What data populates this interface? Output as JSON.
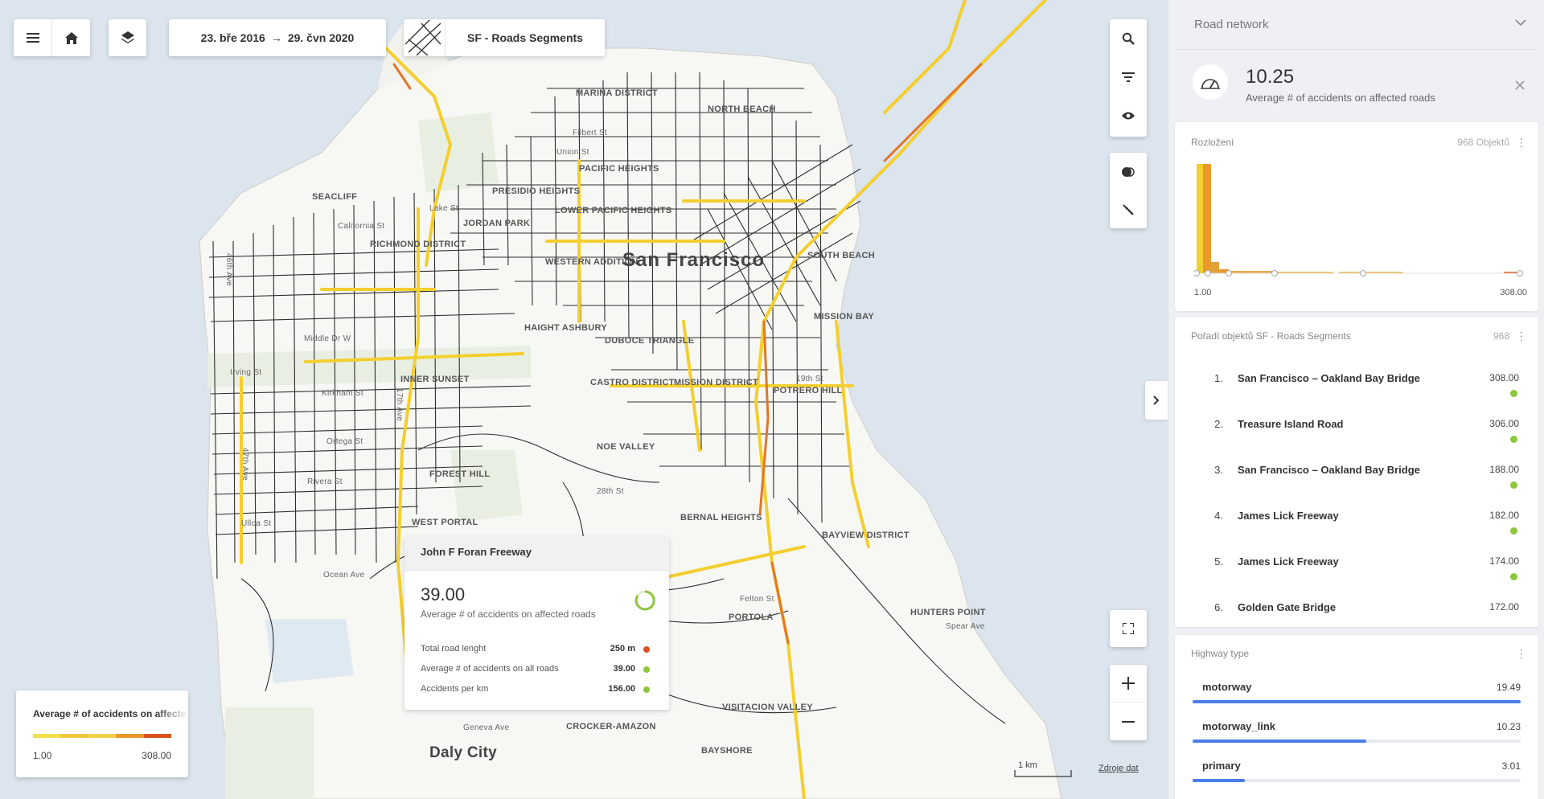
{
  "toolbar": {
    "date_from": "23. bře 2016",
    "date_arrow": "→",
    "date_to": "29. čvn 2020",
    "layer_name": "SF - Roads Segments"
  },
  "map": {
    "labels": [
      "MARINA DISTRICT",
      "NORTH BEACH",
      "SEACLIFF",
      "PRESIDIO HEIGHTS",
      "JORDAN PARK",
      "RICHMOND DISTRICT",
      "LOWER PACIFIC HEIGHTS",
      "PACIFIC HEIGHTS",
      "WESTERN ADDITION",
      "HAIGHT ASHBURY",
      "DUBOCE TRIANGLE",
      "SOUTH BEACH",
      "MISSION BAY",
      "INNER SUNSET",
      "CASTRO DISTRICT",
      "MISSION DISTRICT",
      "POTRERO HILL",
      "NOE VALLEY",
      "FOREST HILL",
      "WEST PORTAL",
      "BERNAL HEIGHTS",
      "BAYVIEW DISTRICT",
      "HUNTERS POINT",
      "PORTOLA",
      "VISITACION VALLEY",
      "CROCKER-AMAZON",
      "BAYSHORE"
    ],
    "streets": [
      "California St",
      "Lake St",
      "Filbert St",
      "Union St",
      "Irving St",
      "Kirkham St",
      "Ortega St",
      "Rivera St",
      "Ulloa St",
      "Ocean Ave",
      "Middle Dr W",
      "19th St",
      "28th St",
      "Geneva Ave",
      "Felton St",
      "Spear Ave",
      "47th Ave",
      "46th Ave",
      "17th Ave"
    ],
    "city_label": "San Francisco",
    "daly_city": "Daly City",
    "scale_label": "1 km",
    "data_source_link": "Zdroje dat"
  },
  "legend": {
    "title": "Average # of accidents on affected roads",
    "min": "1.00",
    "max": "308.00",
    "colors": [
      "#f5e04a",
      "#f0c93a",
      "#f2d24b",
      "#e99a2a",
      "#d9531f"
    ]
  },
  "popup": {
    "title": "John F Foran Freeway",
    "value": "39.00",
    "value_label": "Average # of accidents on affected roads",
    "rows": [
      {
        "label": "Total road lenght",
        "value": "250 m",
        "color": "#d9531f"
      },
      {
        "label": "Average # of accidents on all roads",
        "value": "39.00",
        "color": "#8cc63f"
      },
      {
        "label": "Accidents per km",
        "value": "156.00",
        "color": "#8cc63f"
      }
    ]
  },
  "panel": {
    "title": "Road network",
    "kpi_value": "10.25",
    "kpi_label": "Average # of accidents on affected roads",
    "distribution": {
      "title": "Rozložení",
      "count": "968 Objektů",
      "min": "1.00",
      "max": "308.00"
    },
    "ranking": {
      "title": "Pořadí objektů SF - Roads Segments",
      "count": "968",
      "items": [
        {
          "rank": "1.",
          "name": "San Francisco – Oakland Bay Bridge",
          "value": "308.00"
        },
        {
          "rank": "2.",
          "name": "Treasure Island Road",
          "value": "306.00"
        },
        {
          "rank": "3.",
          "name": "San Francisco – Oakland Bay Bridge",
          "value": "188.00"
        },
        {
          "rank": "4.",
          "name": "James Lick Freeway",
          "value": "182.00"
        },
        {
          "rank": "5.",
          "name": "James Lick Freeway",
          "value": "174.00"
        },
        {
          "rank": "6.",
          "name": "Golden Gate Bridge",
          "value": "172.00"
        }
      ]
    },
    "highway": {
      "title": "Highway type",
      "items": [
        {
          "name": "motorway",
          "value": "19.49",
          "fraction": 1.0
        },
        {
          "name": "motorway_link",
          "value": "10.23",
          "fraction": 0.53
        },
        {
          "name": "primary",
          "value": "3.01",
          "fraction": 0.16
        }
      ]
    }
  }
}
